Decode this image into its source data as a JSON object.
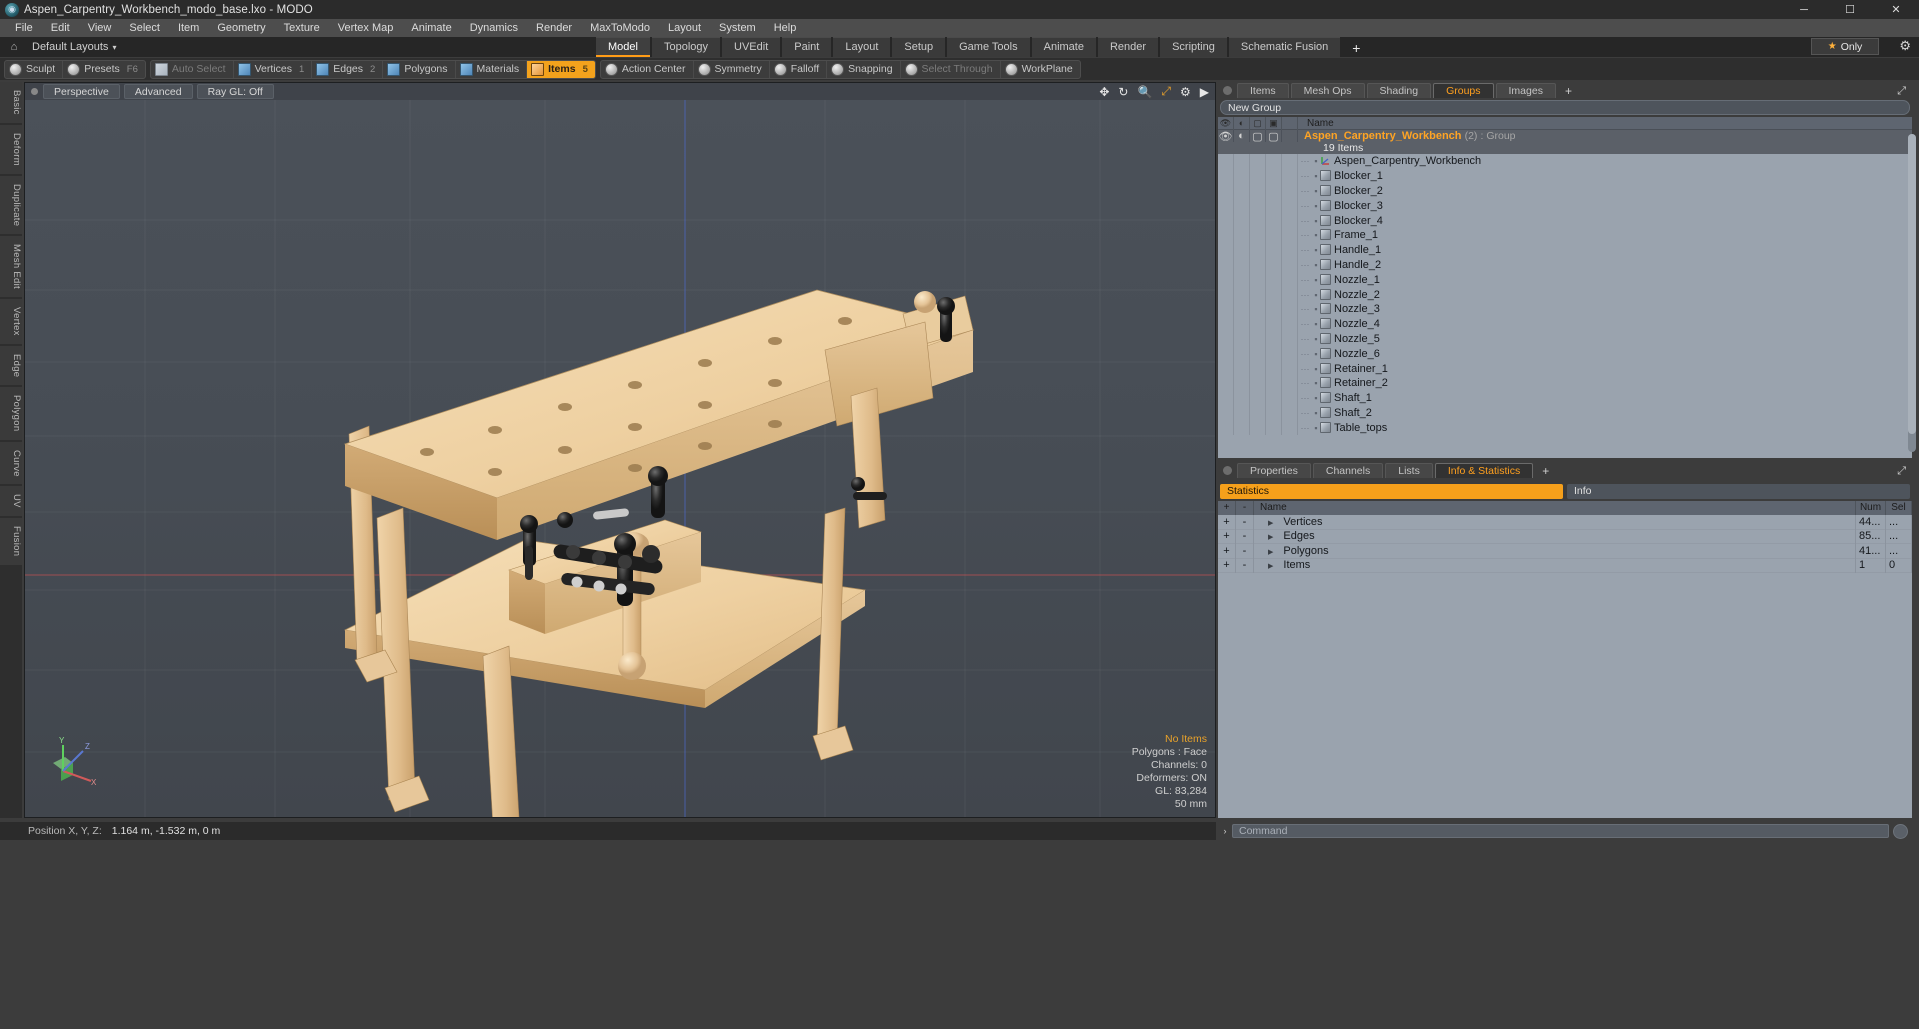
{
  "window": {
    "title": "Aspen_Carpentry_Workbench_modo_base.lxo - MODO",
    "app_icon": "modo-logo-icon",
    "minimize": "─",
    "maximize": "☐",
    "close": "✕"
  },
  "menu": {
    "items": [
      "File",
      "Edit",
      "View",
      "Select",
      "Item",
      "Geometry",
      "Texture",
      "Vertex Map",
      "Animate",
      "Dynamics",
      "Render",
      "MaxToModo",
      "Layout",
      "System",
      "Help"
    ]
  },
  "layout_bar": {
    "home_icon": "home-icon",
    "label": "Default Layouts",
    "caret": "▾",
    "only_label": "Only",
    "only_star": "★",
    "gear_icon": "gear-icon"
  },
  "layout_tabs": {
    "items": [
      "Model",
      "Topology",
      "UVEdit",
      "Paint",
      "Layout",
      "Setup",
      "Game Tools",
      "Animate",
      "Render",
      "Scripting",
      "Schematic Fusion"
    ],
    "active": "Model",
    "add": "+"
  },
  "toolbar": {
    "group1": [
      {
        "label": "Sculpt",
        "icon": "brush-icon",
        "state": "normal",
        "num": ""
      },
      {
        "label": "Presets",
        "icon": "sphere-icon",
        "state": "normal",
        "num": "F6"
      }
    ],
    "group2": [
      {
        "label": "Auto Select",
        "icon": "cube-gray-icon",
        "state": "dim",
        "num": ""
      },
      {
        "label": "Vertices",
        "icon": "cube-blue-icon",
        "state": "normal",
        "num": "1"
      },
      {
        "label": "Edges",
        "icon": "cube-blue-icon",
        "state": "normal",
        "num": "2"
      },
      {
        "label": "Polygons",
        "icon": "cube-blue-icon",
        "state": "normal",
        "num": ""
      },
      {
        "label": "Materials",
        "icon": "cube-blue-icon",
        "state": "normal",
        "num": ""
      },
      {
        "label": "Items",
        "icon": "cube-orange-icon",
        "state": "active",
        "num": "5"
      }
    ],
    "group3": [
      {
        "label": "Action Center",
        "icon": "target-icon",
        "state": "normal",
        "num": ""
      },
      {
        "label": "Symmetry",
        "icon": "symmetry-icon",
        "state": "normal",
        "num": ""
      },
      {
        "label": "Falloff",
        "icon": "falloff-icon",
        "state": "normal",
        "num": ""
      },
      {
        "label": "Snapping",
        "icon": "snapping-icon",
        "state": "normal",
        "num": ""
      },
      {
        "label": "Select Through",
        "icon": "select-through-icon",
        "state": "dim",
        "num": ""
      },
      {
        "label": "WorkPlane",
        "icon": "workplane-icon",
        "state": "normal",
        "num": ""
      }
    ]
  },
  "left_tabs": {
    "items": [
      "Basic",
      "Deform",
      "Duplicate",
      "Mesh Edit",
      "Vertex",
      "Edge",
      "Polygon",
      "Curve",
      "UV",
      "Fusion"
    ]
  },
  "viewport": {
    "tabs": [
      "Perspective",
      "Advanced",
      "Ray GL: Off"
    ],
    "icons": [
      "move-icon",
      "rotate-icon",
      "zoom-icon",
      "fit-icon",
      "gear-icon",
      "play-icon"
    ],
    "dot": "viewport-menu-dot",
    "stats": {
      "no_items": "No Items",
      "polygons": "Polygons : Face",
      "channels": "Channels: 0",
      "deformers": "Deformers: ON",
      "gl": "GL: 83,284",
      "scale": "50 mm"
    },
    "gizmo": {
      "x": "X",
      "y": "Y",
      "z": "Z"
    }
  },
  "right_panel": {
    "tabs": [
      "Items",
      "Mesh Ops",
      "Shading",
      "Groups",
      "Images"
    ],
    "active_tab": "Groups",
    "add": "+",
    "expand_icon": "expand-icon",
    "group_field": "New Group",
    "list_header": {
      "columns": [
        "eye-icon",
        "render-icon",
        "wire-icon",
        "shade-icon"
      ],
      "name": "Name"
    },
    "group": {
      "icon": "group-icon",
      "name": "Aspen_Carpentry_Workbench",
      "count": "(2)",
      "type": ": Group",
      "subtitle": "19 Items"
    },
    "items": [
      {
        "name": "Aspen_Carpentry_Workbench",
        "icon": "locator-icon"
      },
      {
        "name": "Blocker_1",
        "icon": "mesh-icon"
      },
      {
        "name": "Blocker_2",
        "icon": "mesh-icon"
      },
      {
        "name": "Blocker_3",
        "icon": "mesh-icon"
      },
      {
        "name": "Blocker_4",
        "icon": "mesh-icon"
      },
      {
        "name": "Frame_1",
        "icon": "mesh-icon"
      },
      {
        "name": "Handle_1",
        "icon": "mesh-icon"
      },
      {
        "name": "Handle_2",
        "icon": "mesh-icon"
      },
      {
        "name": "Nozzle_1",
        "icon": "mesh-icon"
      },
      {
        "name": "Nozzle_2",
        "icon": "mesh-icon"
      },
      {
        "name": "Nozzle_3",
        "icon": "mesh-icon"
      },
      {
        "name": "Nozzle_4",
        "icon": "mesh-icon"
      },
      {
        "name": "Nozzle_5",
        "icon": "mesh-icon"
      },
      {
        "name": "Nozzle_6",
        "icon": "mesh-icon"
      },
      {
        "name": "Retainer_1",
        "icon": "mesh-icon"
      },
      {
        "name": "Retainer_2",
        "icon": "mesh-icon"
      },
      {
        "name": "Shaft_1",
        "icon": "mesh-icon"
      },
      {
        "name": "Shaft_2",
        "icon": "mesh-icon"
      },
      {
        "name": "Table_tops",
        "icon": "mesh-icon"
      }
    ]
  },
  "bottom_panel": {
    "tabs": [
      "Properties",
      "Channels",
      "Lists",
      "Info & Statistics"
    ],
    "active_tab": "Info & Statistics",
    "add": "+",
    "expand_icon": "expand-icon",
    "arrow_icon": "chevron-right-icon",
    "sub_tabs": {
      "active": "Statistics",
      "inactive": "Info"
    },
    "table": {
      "headers": [
        "+",
        "-",
        "Name",
        "Num",
        "Sel"
      ],
      "rows": [
        {
          "plus": "+",
          "minus": "-",
          "arrow": "▶",
          "name": "Vertices",
          "num": "44...",
          "sel": "..."
        },
        {
          "plus": "+",
          "minus": "-",
          "arrow": "▶",
          "name": "Edges",
          "num": "85...",
          "sel": "..."
        },
        {
          "plus": "+",
          "minus": "-",
          "arrow": "▶",
          "name": "Polygons",
          "num": "41...",
          "sel": "..."
        },
        {
          "plus": "+",
          "minus": "-",
          "arrow": "▶",
          "name": "Items",
          "num": "1",
          "sel": "0"
        }
      ]
    }
  },
  "status_bar": {
    "position_label": "Position X, Y, Z:",
    "position_value": "1.164 m, -1.532 m, 0 m"
  },
  "command_bar": {
    "arrow": "›",
    "placeholder": "Command",
    "help_icon": "help-icon"
  },
  "colors": {
    "accent_orange": "#ffa424",
    "active_button": "#f3a21c",
    "panel_light": "#9aa3ae",
    "viewport_bg": "#454b53"
  }
}
